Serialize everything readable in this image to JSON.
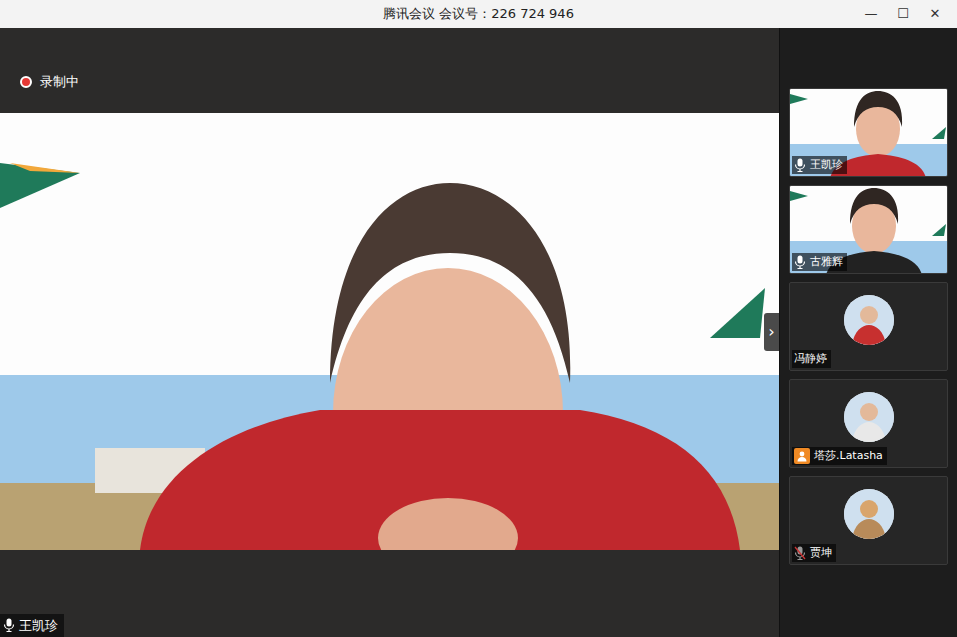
{
  "window": {
    "title": "腾讯会议 会议号：226 724 946",
    "controls": [
      "—",
      "☐",
      "✕"
    ]
  },
  "recording": {
    "label": "录制中",
    "on": true
  },
  "speaker": {
    "name": "王凯珍",
    "indicator": "mic"
  },
  "sidebar_toggle": "›",
  "participants": [
    {
      "name": "王凯珍",
      "kind": "video",
      "indicator": "mic"
    },
    {
      "name": "古雅辉",
      "kind": "video",
      "indicator": "mic"
    },
    {
      "name": "冯静婷",
      "kind": "avatar",
      "indicator": "none"
    },
    {
      "name": "塔莎.Latasha",
      "kind": "avatar",
      "indicator": "guest"
    },
    {
      "name": "贾坤",
      "kind": "avatar",
      "indicator": "mic-off"
    }
  ]
}
